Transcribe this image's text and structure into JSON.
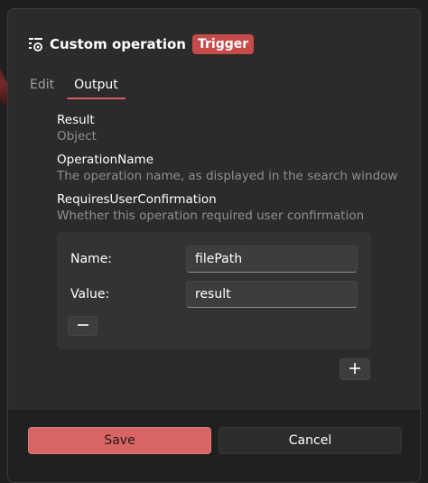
{
  "dialog": {
    "title": "Custom operation",
    "badge": "Trigger",
    "title_icon": "custom-operation-icon"
  },
  "tabs": [
    {
      "label": "Edit",
      "active": false
    },
    {
      "label": "Output",
      "active": true
    }
  ],
  "output_fields": [
    {
      "name": "Result",
      "description": "Object"
    },
    {
      "name": "OperationName",
      "description": "The operation name, as displayed in the search window"
    },
    {
      "name": "RequiresUserConfirmation",
      "description": "Whether this operation required user confirmation"
    }
  ],
  "parameter": {
    "name_label": "Name:",
    "name_value": "filePath",
    "value_label": "Value:",
    "value_value": "result",
    "remove_icon": "minus-icon",
    "add_icon": "plus-icon"
  },
  "footer": {
    "save_label": "Save",
    "cancel_label": "Cancel"
  },
  "colors": {
    "accent": "#d76565",
    "badge": "#c84b4b",
    "dialog_bg": "#2b2b2b",
    "panel_bg": "#333333"
  }
}
